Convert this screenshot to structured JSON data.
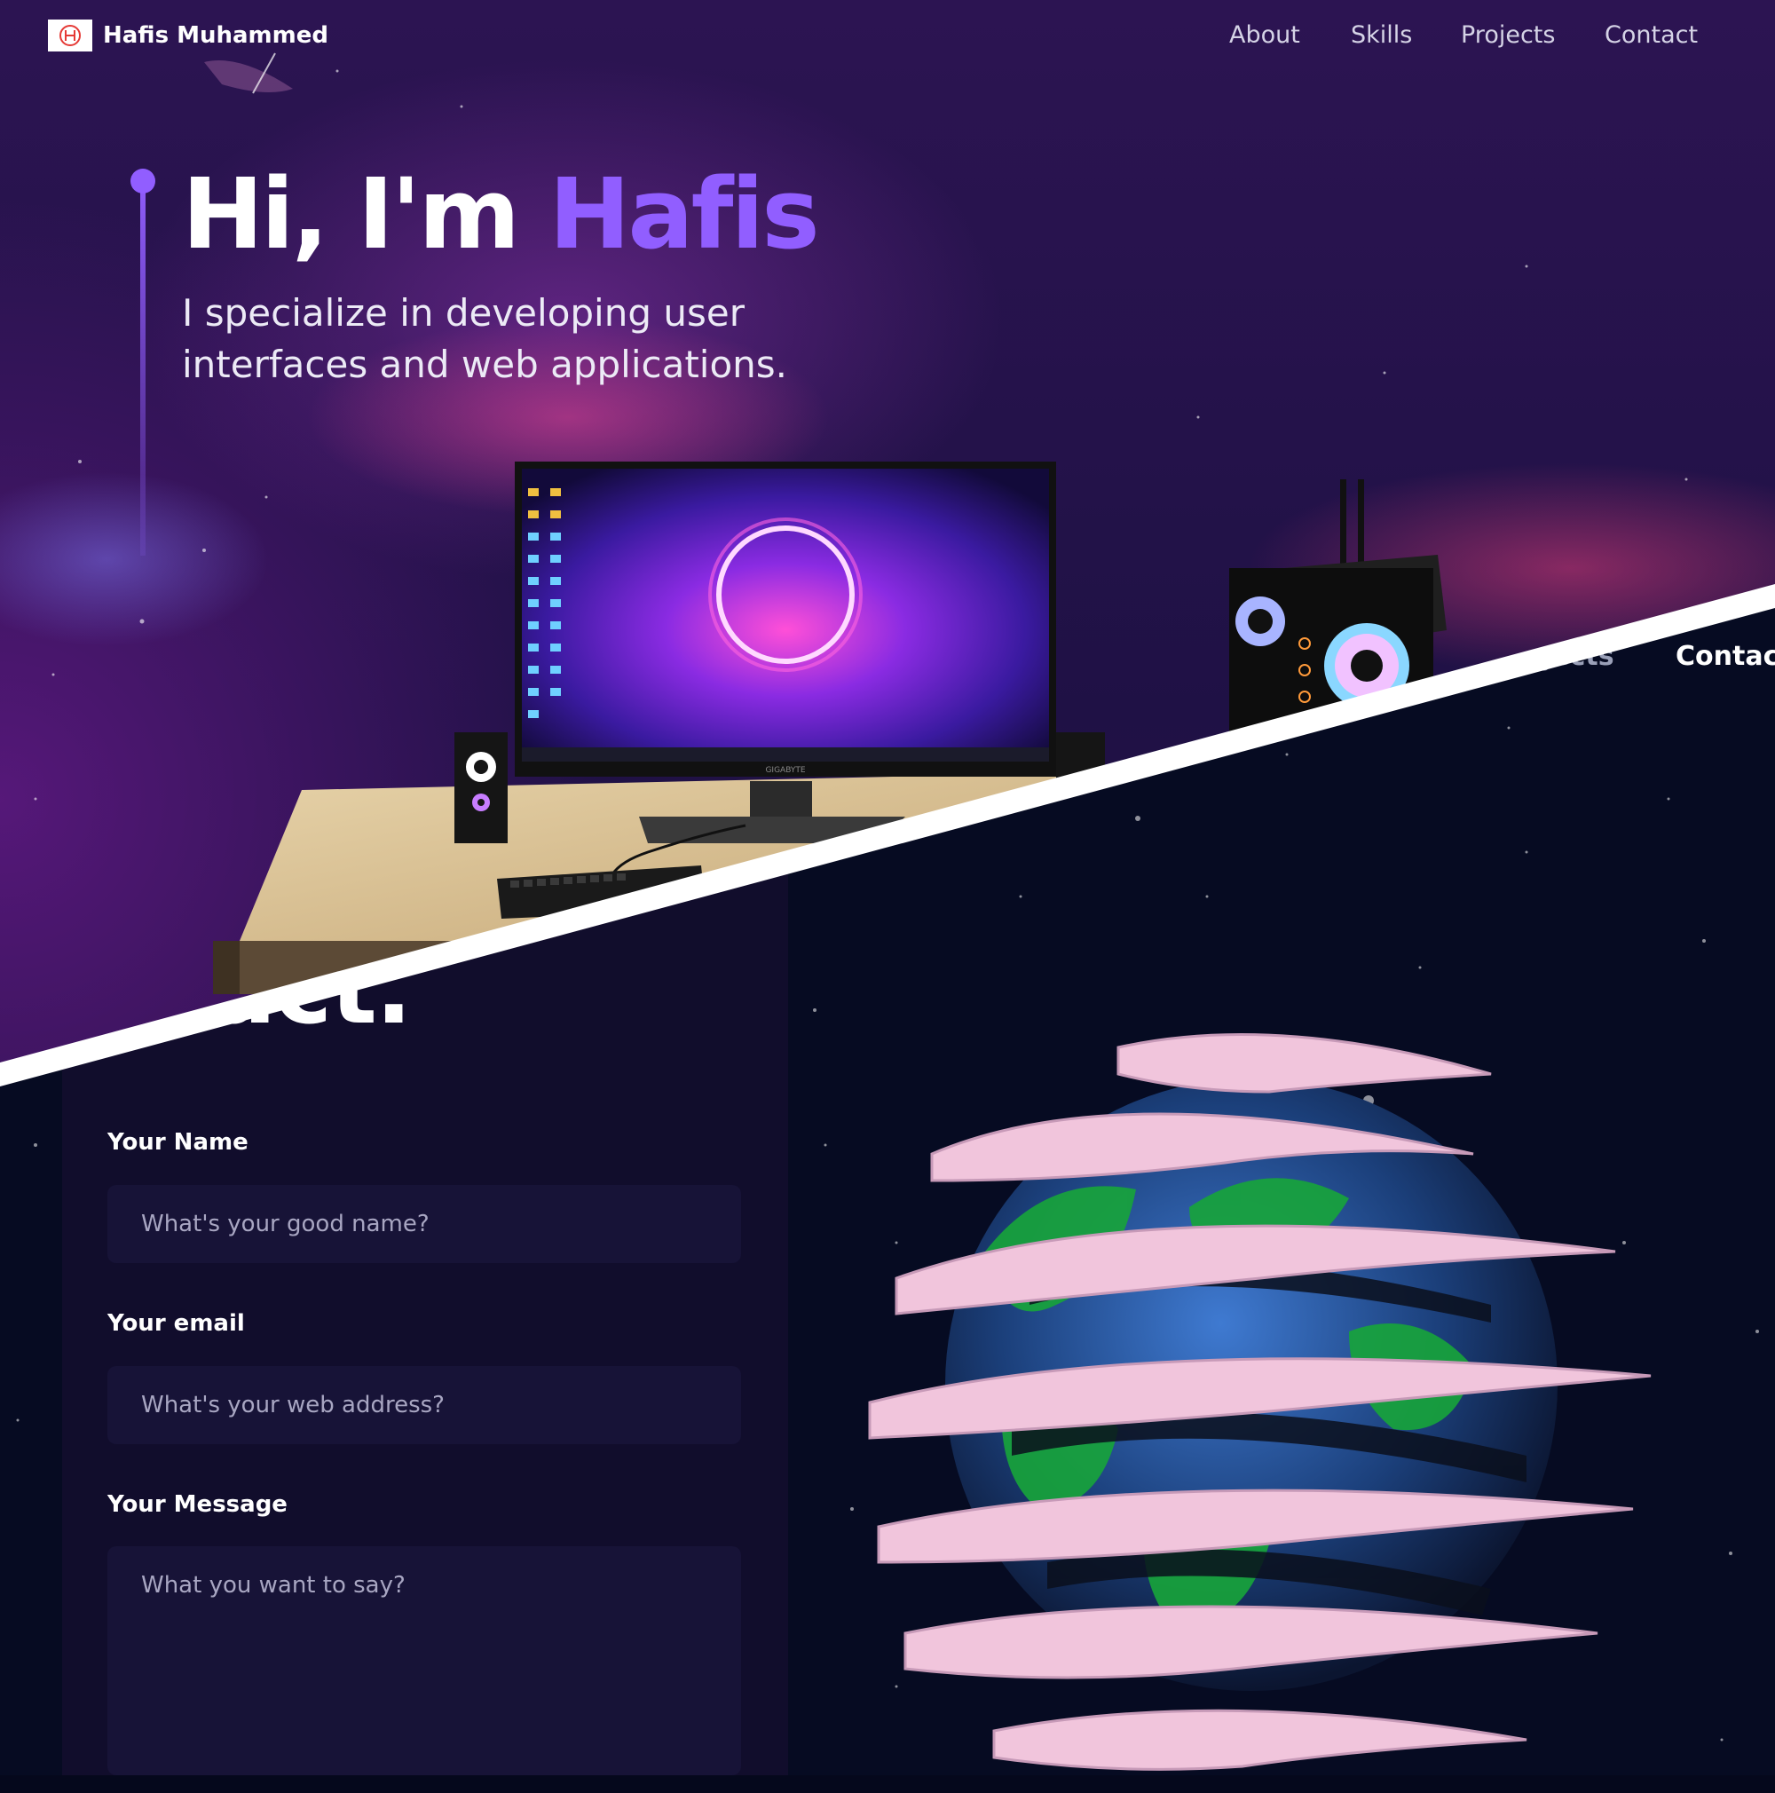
{
  "hero": {
    "logo_name": "Hafis Muhammed",
    "logo_icon": "H-monogram-icon",
    "nav": [
      "About",
      "Skills",
      "Projects",
      "Contact"
    ],
    "greeting": "Hi, I'm ",
    "name_highlight": "Hafis",
    "subtitle": "I specialize in developing user interfaces and web applications.",
    "monitor_brand": "GIGABYTE"
  },
  "contact": {
    "heading": "ntact.",
    "nav_partial": "jects",
    "nav_active": "Contact",
    "form": {
      "name_label": "Your Name",
      "name_placeholder": "What's your good name?",
      "email_label": "Your email",
      "email_placeholder": "What's your web address?",
      "message_label": "Your Message",
      "message_placeholder": "What you want to say?"
    }
  },
  "colors": {
    "accent": "#915eff",
    "hero_bg": "#2a1250",
    "contact_bg": "#060b22",
    "form_panel": "#110d2c",
    "input_bg": "#171337"
  }
}
